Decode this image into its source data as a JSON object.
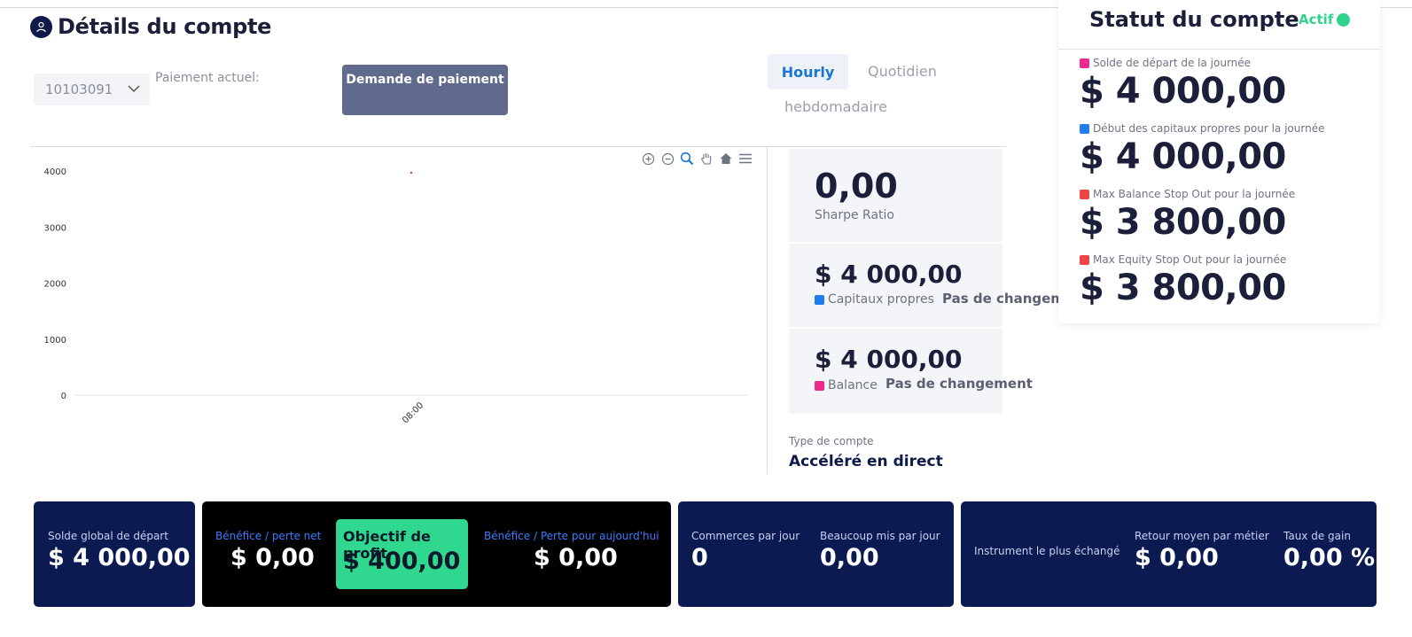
{
  "header": {
    "title": "Détails du compte",
    "icon": "user-icon"
  },
  "account": {
    "selected_id": "10103091",
    "current_payment_label": "Paiement actuel:",
    "payment_request_button": "Demande de paiement"
  },
  "tabs": [
    {
      "label": "Hourly",
      "active": true
    },
    {
      "label": "Quotidien",
      "active": false
    },
    {
      "label": "hebdomadaire",
      "active": false
    }
  ],
  "chart_data": {
    "type": "scatter",
    "categories": [
      "08:00"
    ],
    "series": [
      {
        "values": [
          4000
        ],
        "color": "#e53935"
      }
    ],
    "ylim": [
      0,
      4000
    ],
    "yticks": [
      "4000",
      "3000",
      "2000",
      "1000",
      "0"
    ],
    "xticks": [
      "08:00"
    ],
    "grid": false
  },
  "toolbar_icons": [
    "zoom-in-icon",
    "zoom-out-icon",
    "zoom-select-icon",
    "pan-icon",
    "home-icon",
    "menu-icon"
  ],
  "metrics": {
    "sharpe": {
      "value": "0,00",
      "label": "Sharpe Ratio"
    },
    "equity": {
      "value": "$ 4 000,00",
      "label": "Capitaux propres",
      "change": "Pas de changement",
      "color": "#1e7ef0"
    },
    "balance": {
      "value": "$ 4 000,00",
      "label": "Balance",
      "change": "Pas de changement",
      "color": "#ee2a8f"
    },
    "account_type_label": "Type de compte",
    "account_type_value": "Accéléré en direct"
  },
  "status": {
    "title": "Statut du compte",
    "badge": "Actif",
    "badge_color": "#2fd38a",
    "items": [
      {
        "label": "Solde de départ de la journée",
        "value": "$ 4 000,00",
        "color": "#ee2a8f"
      },
      {
        "label": "Début des capitaux propres pour la journée",
        "value": "$ 4 000,00",
        "color": "#1e7ef0"
      },
      {
        "label": "Max Balance Stop Out pour la journée",
        "value": "$ 3 800,00",
        "color": "#ef4444"
      },
      {
        "label": "Max Equity Stop Out pour la journée",
        "value": "$ 3 800,00",
        "color": "#ef4444"
      }
    ]
  },
  "cards": {
    "starting_balance": {
      "label": "Solde global de départ",
      "value": "$ 4 000,00"
    },
    "net_pl": {
      "label": "Bénéfice / perte net",
      "value": "$ 0,00"
    },
    "profit_goal": {
      "label": "Objectif de profit",
      "value": "$ 400,00"
    },
    "today_pl": {
      "label": "Bénéfice / Perte pour aujourd'hui",
      "value": "$ 0,00"
    },
    "trades_per_day": {
      "label": "Commerces par jour",
      "value": "0"
    },
    "lots_per_day": {
      "label": "Beaucoup mis par jour",
      "value": "0,00"
    },
    "most_traded": {
      "label": "Instrument le plus échangé",
      "value": ""
    },
    "avg_return": {
      "label": "Retour moyen par métier",
      "value": "$ 0,00"
    },
    "win_rate": {
      "label": "Taux de gain",
      "value": "0,00 %"
    }
  }
}
